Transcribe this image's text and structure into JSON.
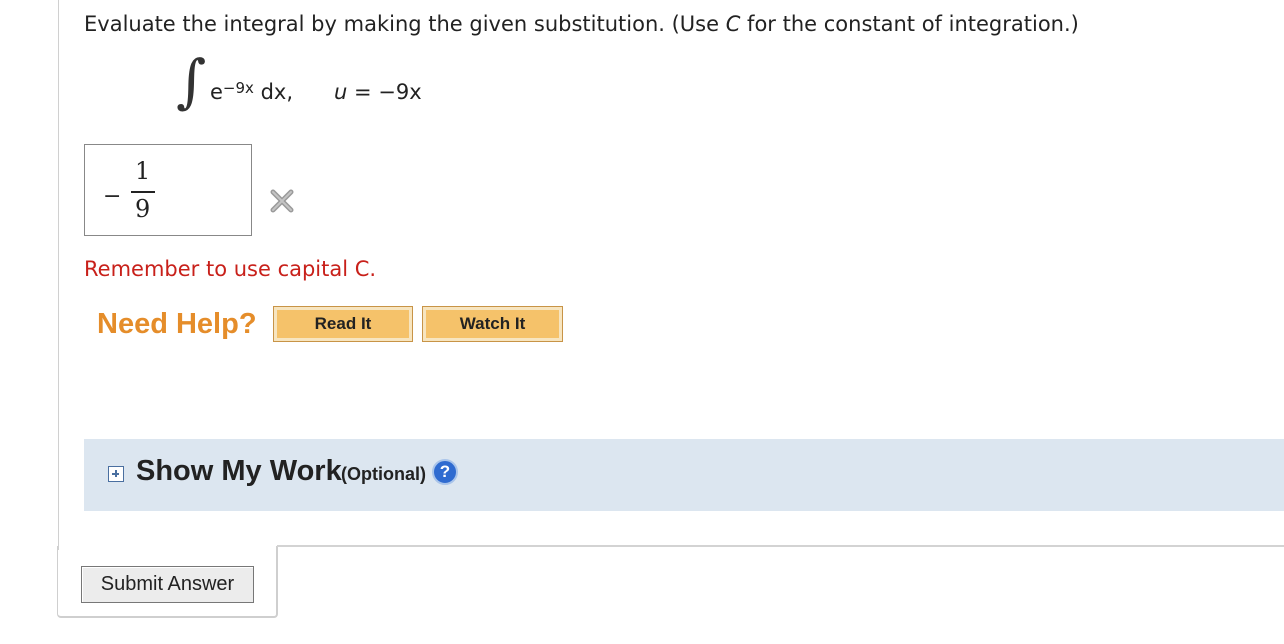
{
  "question": {
    "text_before": "Evaluate the integral by making the given substitution. (Use ",
    "constant_var": "C",
    "text_after": " for the constant of integration.)"
  },
  "integral": {
    "sign": "∫",
    "base": "e",
    "exponent": "−9x",
    "differential": " dx,",
    "sub_var": "u",
    "sub_rest": " = −9x"
  },
  "answer": {
    "sign": "−",
    "numerator": "1",
    "denominator": "9",
    "status": "incorrect"
  },
  "feedback": {
    "text": "Remember to use capital C."
  },
  "help": {
    "title": "Need Help?",
    "read_label": "Read It",
    "watch_label": "Watch It"
  },
  "show_work": {
    "title": "Show My Work",
    "optional": "(Optional)",
    "help_glyph": "?"
  },
  "submit": {
    "label": "Submit Answer"
  },
  "colors": {
    "feedback": "#c8201a",
    "need_help": "#e58d2a",
    "button_fill": "#f5c26a",
    "work_bar": "#dce6f0",
    "help_icon": "#2f6bd0"
  },
  "icons": {
    "wrong": "x-mark-icon",
    "expand": "plus-box-icon",
    "help": "question-circle-icon"
  }
}
